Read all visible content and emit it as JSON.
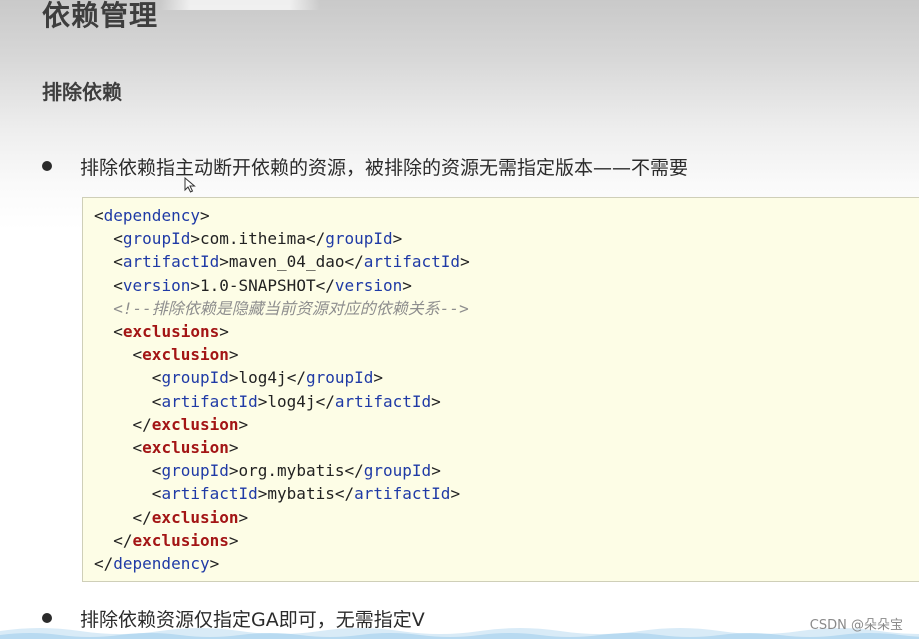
{
  "page": {
    "title": "依赖管理",
    "section_title": "排除依赖"
  },
  "bullets": [
    {
      "text": "排除依赖指主动断开依赖的资源，被排除的资源无需指定版本——不需要"
    },
    {
      "text": "排除依赖资源仅指定GA即可，无需指定V"
    }
  ],
  "code": {
    "lines": [
      {
        "parts": [
          {
            "t": "<",
            "c": "punct"
          },
          {
            "t": "dependency",
            "c": "tag-blue"
          },
          {
            "t": ">",
            "c": "punct"
          }
        ]
      },
      {
        "parts": [
          {
            "t": "  <",
            "c": "punct"
          },
          {
            "t": "groupId",
            "c": "tag-blue"
          },
          {
            "t": ">",
            "c": "punct"
          },
          {
            "t": "com.itheima",
            "c": "text-val"
          },
          {
            "t": "</",
            "c": "punct"
          },
          {
            "t": "groupId",
            "c": "tag-blue"
          },
          {
            "t": ">",
            "c": "punct"
          }
        ]
      },
      {
        "parts": [
          {
            "t": "  <",
            "c": "punct"
          },
          {
            "t": "artifactId",
            "c": "tag-blue"
          },
          {
            "t": ">",
            "c": "punct"
          },
          {
            "t": "maven_04_dao",
            "c": "text-val"
          },
          {
            "t": "</",
            "c": "punct"
          },
          {
            "t": "artifactId",
            "c": "tag-blue"
          },
          {
            "t": ">",
            "c": "punct"
          }
        ]
      },
      {
        "parts": [
          {
            "t": "  <",
            "c": "punct"
          },
          {
            "t": "version",
            "c": "tag-blue"
          },
          {
            "t": ">",
            "c": "punct"
          },
          {
            "t": "1.0-SNAPSHOT",
            "c": "text-val"
          },
          {
            "t": "</",
            "c": "punct"
          },
          {
            "t": "version",
            "c": "tag-blue"
          },
          {
            "t": ">",
            "c": "punct"
          }
        ]
      },
      {
        "parts": [
          {
            "t": "  <!--排除依赖是隐藏当前资源对应的依赖关系-->",
            "c": "comment"
          }
        ]
      },
      {
        "parts": [
          {
            "t": "  <",
            "c": "punct"
          },
          {
            "t": "exclusions",
            "c": "tag-red"
          },
          {
            "t": ">",
            "c": "punct"
          }
        ]
      },
      {
        "parts": [
          {
            "t": "    <",
            "c": "punct"
          },
          {
            "t": "exclusion",
            "c": "tag-red"
          },
          {
            "t": ">",
            "c": "punct"
          }
        ]
      },
      {
        "parts": [
          {
            "t": "      <",
            "c": "punct"
          },
          {
            "t": "groupId",
            "c": "tag-blue"
          },
          {
            "t": ">",
            "c": "punct"
          },
          {
            "t": "log4j",
            "c": "text-val"
          },
          {
            "t": "</",
            "c": "punct"
          },
          {
            "t": "groupId",
            "c": "tag-blue"
          },
          {
            "t": ">",
            "c": "punct"
          }
        ]
      },
      {
        "parts": [
          {
            "t": "      <",
            "c": "punct"
          },
          {
            "t": "artifactId",
            "c": "tag-blue"
          },
          {
            "t": ">",
            "c": "punct"
          },
          {
            "t": "log4j",
            "c": "text-val"
          },
          {
            "t": "</",
            "c": "punct"
          },
          {
            "t": "artifactId",
            "c": "tag-blue"
          },
          {
            "t": ">",
            "c": "punct"
          }
        ]
      },
      {
        "parts": [
          {
            "t": "    </",
            "c": "punct"
          },
          {
            "t": "exclusion",
            "c": "tag-red"
          },
          {
            "t": ">",
            "c": "punct"
          }
        ]
      },
      {
        "parts": [
          {
            "t": "    <",
            "c": "punct"
          },
          {
            "t": "exclusion",
            "c": "tag-red"
          },
          {
            "t": ">",
            "c": "punct"
          }
        ]
      },
      {
        "parts": [
          {
            "t": "      <",
            "c": "punct"
          },
          {
            "t": "groupId",
            "c": "tag-blue"
          },
          {
            "t": ">",
            "c": "punct"
          },
          {
            "t": "org.mybatis",
            "c": "text-val"
          },
          {
            "t": "</",
            "c": "punct"
          },
          {
            "t": "groupId",
            "c": "tag-blue"
          },
          {
            "t": ">",
            "c": "punct"
          }
        ]
      },
      {
        "parts": [
          {
            "t": "      <",
            "c": "punct"
          },
          {
            "t": "artifactId",
            "c": "tag-blue"
          },
          {
            "t": ">",
            "c": "punct"
          },
          {
            "t": "mybatis",
            "c": "text-val"
          },
          {
            "t": "</",
            "c": "punct"
          },
          {
            "t": "artifactId",
            "c": "tag-blue"
          },
          {
            "t": ">",
            "c": "punct"
          }
        ]
      },
      {
        "parts": [
          {
            "t": "    </",
            "c": "punct"
          },
          {
            "t": "exclusion",
            "c": "tag-red"
          },
          {
            "t": ">",
            "c": "punct"
          }
        ]
      },
      {
        "parts": [
          {
            "t": "  </",
            "c": "punct"
          },
          {
            "t": "exclusions",
            "c": "tag-red"
          },
          {
            "t": ">",
            "c": "punct"
          }
        ]
      },
      {
        "parts": [
          {
            "t": "</",
            "c": "punct"
          },
          {
            "t": "dependency",
            "c": "tag-blue"
          },
          {
            "t": ">",
            "c": "punct"
          }
        ]
      }
    ]
  },
  "watermark": {
    "text": "CSDN @朵朵宝"
  },
  "icons": {
    "cursor": "arrow-cursor-icon",
    "bullet": "bullet-dot-icon"
  },
  "colors": {
    "tag": "#1f3aa6",
    "tag_emphasis": "#a31515",
    "comment": "#8e8e8e",
    "code_background": "#fdfde6",
    "text": "#2b2b2b"
  }
}
